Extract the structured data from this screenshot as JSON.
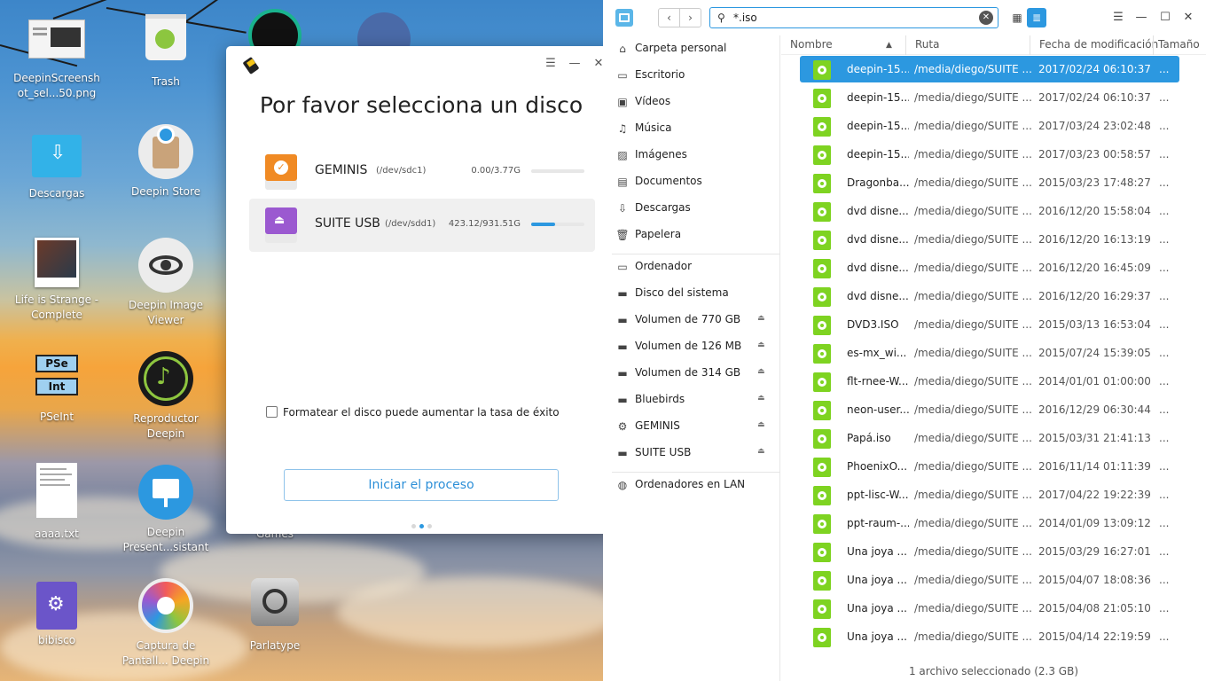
{
  "desktop": {
    "icons": [
      {
        "label": "DeepinScreensh ot_sel...50.png"
      },
      {
        "label": "Trash"
      },
      {
        "label": "Descargas"
      },
      {
        "label": "Deepin Store"
      },
      {
        "label": "Life is Strange - Complete"
      },
      {
        "label": "Deepin Image Viewer"
      },
      {
        "label": "PSeInt"
      },
      {
        "label": "Reproductor Deepin"
      },
      {
        "label": "aaaa.txt"
      },
      {
        "label": "Deepin Present...sistant"
      },
      {
        "label": "bibisco"
      },
      {
        "label": "Captura de Pantall... Deepin"
      },
      {
        "label": "Parlatype"
      },
      {
        "label": "Games"
      }
    ],
    "pseint_text": {
      "top": "PSe",
      "bottom": "Int"
    }
  },
  "dialog": {
    "title": "Por favor selecciona un disco",
    "menu_icon": "☰",
    "minimize_icon": "—",
    "close_icon": "✕",
    "disks": [
      {
        "name": "GEMINIS",
        "device": "(/dev/sdc1)",
        "capacity": "0.00/3.77G",
        "usage": 0.0,
        "icon_color": "#f08a24"
      },
      {
        "name": "SUITE USB",
        "device": "(/dev/sdd1)",
        "capacity": "423.12/931.51G",
        "usage": 0.45,
        "icon_color": "#9b59d0"
      }
    ],
    "format_label": "Formatear el disco puede aumentar la tasa de éxito",
    "format_checked": false,
    "start_button": "Iniciar el proceso",
    "pager_active": 1
  },
  "filemanager": {
    "nav": {
      "back": "‹",
      "forward": "›"
    },
    "search": {
      "icon": "🔍",
      "value": "*.iso",
      "clear": "✕"
    },
    "view": {
      "icons_view": "▦",
      "list_view": "≣"
    },
    "titlebar": {
      "menu": "☰",
      "minimize": "—",
      "maximize": "☐",
      "close": "✕"
    },
    "sidebar": {
      "places": [
        {
          "label": "Carpeta personal",
          "icon": "home-icon",
          "glyph": "⌂"
        },
        {
          "label": "Escritorio",
          "icon": "desktop-icon",
          "glyph": "▭"
        },
        {
          "label": "Vídeos",
          "icon": "video-icon",
          "glyph": "▣"
        },
        {
          "label": "Música",
          "icon": "music-icon",
          "glyph": "♫"
        },
        {
          "label": "Imágenes",
          "icon": "image-icon",
          "glyph": "▨"
        },
        {
          "label": "Documentos",
          "icon": "document-icon",
          "glyph": "▤"
        },
        {
          "label": "Descargas",
          "icon": "download-icon",
          "glyph": "⇩"
        },
        {
          "label": "Papelera",
          "icon": "trash-icon",
          "glyph": "🗑"
        }
      ],
      "devices": [
        {
          "label": "Ordenador",
          "icon": "computer-icon",
          "glyph": "▭",
          "eject": false
        },
        {
          "label": "Disco del sistema",
          "icon": "disk-icon",
          "glyph": "▬",
          "eject": false
        },
        {
          "label": "Volumen de 770 GB",
          "icon": "disk-icon",
          "glyph": "▬",
          "eject": true
        },
        {
          "label": "Volumen de 126 MB",
          "icon": "disk-icon",
          "glyph": "▬",
          "eject": true
        },
        {
          "label": "Volumen de 314 GB",
          "icon": "disk-icon",
          "glyph": "▬",
          "eject": true
        },
        {
          "label": "Bluebirds",
          "icon": "disk-icon",
          "glyph": "▬",
          "eject": true
        },
        {
          "label": "GEMINIS",
          "icon": "usb-icon",
          "glyph": "⚙",
          "eject": true
        },
        {
          "label": "SUITE USB",
          "icon": "disk-icon",
          "glyph": "▬",
          "eject": true
        }
      ],
      "network": [
        {
          "label": "Ordenadores en LAN",
          "icon": "network-icon",
          "glyph": "◍"
        }
      ],
      "eject_glyph": "⏏"
    },
    "columns": {
      "name": "Nombre",
      "path": "Ruta",
      "modified": "Fecha de modificación",
      "size": "Tamaño",
      "sort_arrow": "▲"
    },
    "files": [
      {
        "name": "deepin-15...",
        "path": "/media/diego/SUITE ...",
        "date": "2017/02/24 06:10:37",
        "size": "...",
        "selected": true
      },
      {
        "name": "deepin-15...",
        "path": "/media/diego/SUITE ...",
        "date": "2017/02/24 06:10:37",
        "size": "..."
      },
      {
        "name": "deepin-15...",
        "path": "/media/diego/SUITE ...",
        "date": "2017/03/24 23:02:48",
        "size": "..."
      },
      {
        "name": "deepin-15...",
        "path": "/media/diego/SUITE ...",
        "date": "2017/03/23 00:58:57",
        "size": "..."
      },
      {
        "name": "Dragonba...",
        "path": "/media/diego/SUITE ...",
        "date": "2015/03/23 17:48:27",
        "size": "..."
      },
      {
        "name": "dvd disne...",
        "path": "/media/diego/SUITE ...",
        "date": "2016/12/20 15:58:04",
        "size": "..."
      },
      {
        "name": "dvd disne...",
        "path": "/media/diego/SUITE ...",
        "date": "2016/12/20 16:13:19",
        "size": "..."
      },
      {
        "name": "dvd disne...",
        "path": "/media/diego/SUITE ...",
        "date": "2016/12/20 16:45:09",
        "size": "..."
      },
      {
        "name": "dvd disne...",
        "path": "/media/diego/SUITE ...",
        "date": "2016/12/20 16:29:37",
        "size": "..."
      },
      {
        "name": "DVD3.ISO",
        "path": "/media/diego/SUITE ...",
        "date": "2015/03/13 16:53:04",
        "size": "..."
      },
      {
        "name": "es-mx_wi...",
        "path": "/media/diego/SUITE ...",
        "date": "2015/07/24 15:39:05",
        "size": "..."
      },
      {
        "name": "flt-rnee-W...",
        "path": "/media/diego/SUITE ...",
        "date": "2014/01/01 01:00:00",
        "size": "..."
      },
      {
        "name": "neon-user...",
        "path": "/media/diego/SUITE ...",
        "date": "2016/12/29 06:30:44",
        "size": "..."
      },
      {
        "name": "Papá.iso",
        "path": "/media/diego/SUITE ...",
        "date": "2015/03/31 21:41:13",
        "size": "..."
      },
      {
        "name": "PhoenixO...",
        "path": "/media/diego/SUITE ...",
        "date": "2016/11/14 01:11:39",
        "size": "..."
      },
      {
        "name": "ppt-lisc-W...",
        "path": "/media/diego/SUITE ...",
        "date": "2017/04/22 19:22:39",
        "size": "..."
      },
      {
        "name": "ppt-raum-...",
        "path": "/media/diego/SUITE ...",
        "date": "2014/01/09 13:09:12",
        "size": "..."
      },
      {
        "name": "Una joya ...",
        "path": "/media/diego/SUITE ...",
        "date": "2015/03/29 16:27:01",
        "size": "..."
      },
      {
        "name": "Una joya ...",
        "path": "/media/diego/SUITE ...",
        "date": "2015/04/07 18:08:36",
        "size": "..."
      },
      {
        "name": "Una joya ...",
        "path": "/media/diego/SUITE ...",
        "date": "2015/04/08 21:05:10",
        "size": "..."
      },
      {
        "name": "Una joya ...",
        "path": "/media/diego/SUITE ...",
        "date": "2015/04/14 22:19:59",
        "size": "..."
      }
    ],
    "status": "1 archivo seleccionado (2.3 GB)"
  }
}
